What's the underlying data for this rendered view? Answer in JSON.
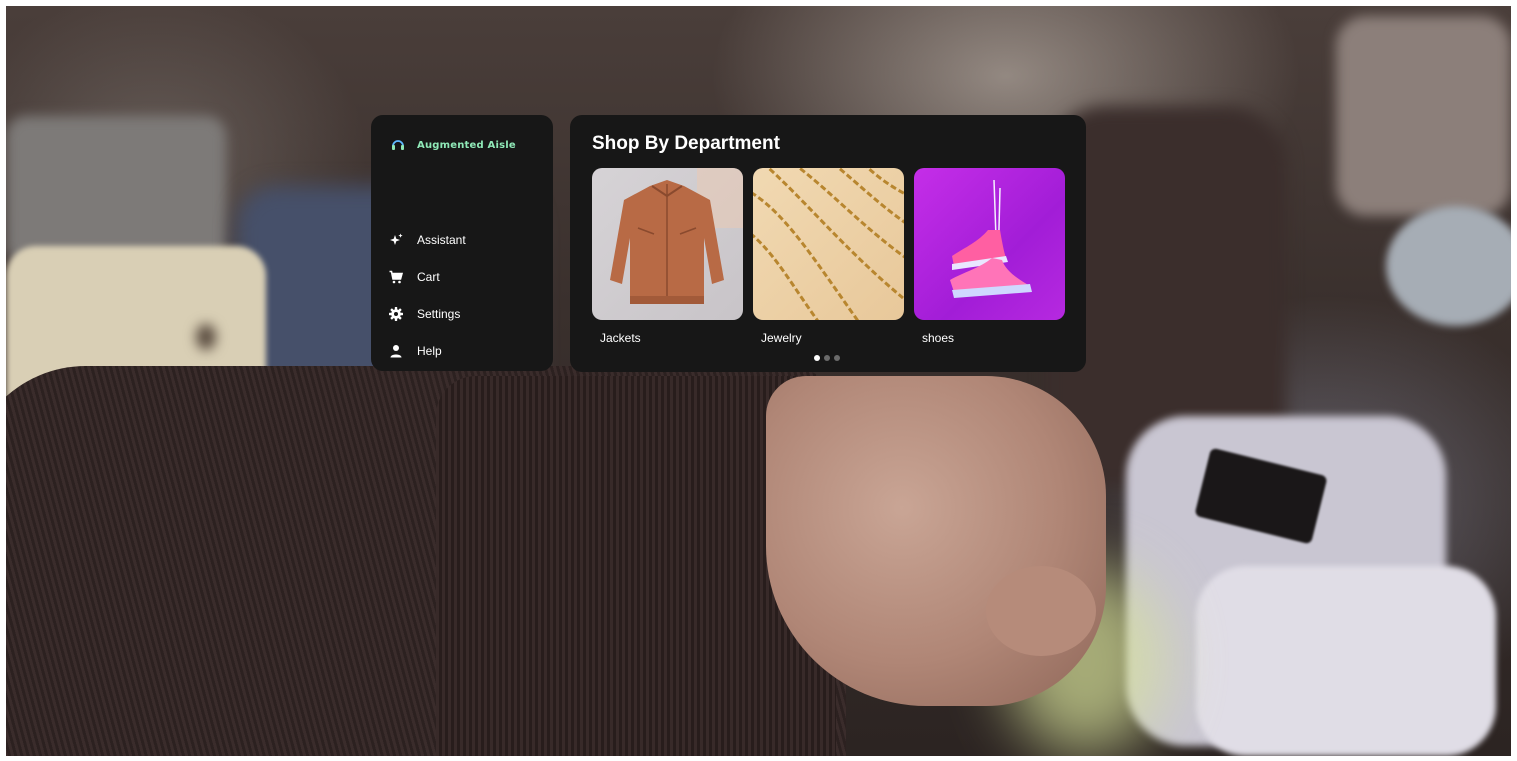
{
  "sidebar": {
    "brand": {
      "name": "Augmented Aisle",
      "icon": "headset-icon",
      "color": "#8fe8b7"
    },
    "items": [
      {
        "label": "Assistant",
        "icon": "sparkle-icon"
      },
      {
        "label": "Cart",
        "icon": "cart-icon"
      },
      {
        "label": "Settings",
        "icon": "gear-icon"
      },
      {
        "label": "Help",
        "icon": "person-icon"
      }
    ]
  },
  "departments": {
    "title": "Shop By Department",
    "cards": [
      {
        "label": "Jackets",
        "image": "jacket-image"
      },
      {
        "label": "Jewelry",
        "image": "jewelry-image"
      },
      {
        "label": "shoes",
        "image": "shoes-image"
      }
    ],
    "pagination": {
      "pages": 3,
      "active": 1
    }
  },
  "colors": {
    "panel_bg": "#171717",
    "accent": "#8fe8b7",
    "dot_inactive": "#6b6b6b"
  }
}
